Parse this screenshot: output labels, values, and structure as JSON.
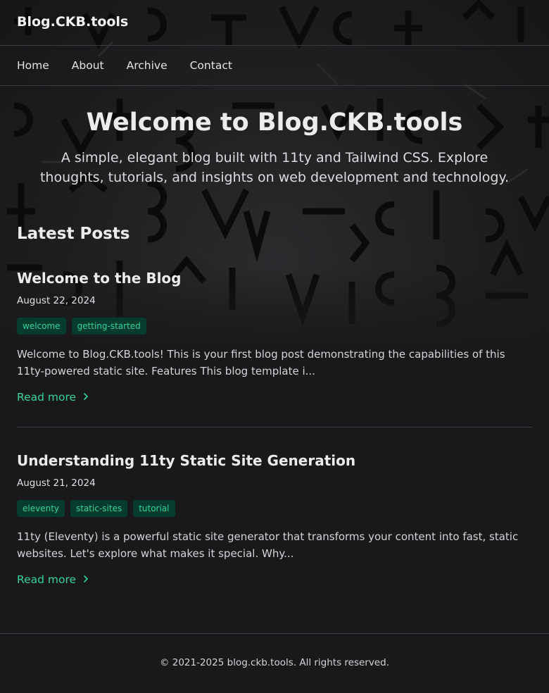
{
  "header": {
    "brand": "Blog.CKB.tools"
  },
  "nav": {
    "items": [
      "Home",
      "About",
      "Archive",
      "Contact"
    ]
  },
  "hero": {
    "title": "Welcome to Blog.CKB.tools",
    "subtitle": "A simple, elegant blog built with 11ty and Tailwind CSS. Explore thoughts, tutorials, and insights on web development and technology."
  },
  "latest": {
    "heading": "Latest Posts",
    "posts": [
      {
        "title": "Welcome to the Blog",
        "date": "August 22, 2024",
        "tags": [
          "welcome",
          "getting-started"
        ],
        "excerpt": "Welcome to Blog.CKB.tools! This is your first blog post demonstrating the capabilities of this 11ty-powered static site. Features This blog template i...",
        "read_more": "Read more"
      },
      {
        "title": "Understanding 11ty Static Site Generation",
        "date": "August 21, 2024",
        "tags": [
          "eleventy",
          "static-sites",
          "tutorial"
        ],
        "excerpt": "11ty (Eleventy) is a powerful static site generator that transforms your content into fast, static websites. Let's explore what makes it special. Why...",
        "read_more": "Read more"
      }
    ]
  },
  "footer": {
    "copyright": "© 2021-2025 blog.ckb.tools. All rights reserved."
  },
  "colors": {
    "accent": "#34d399",
    "tag_bg": "#063c2e",
    "background": "#19191b"
  },
  "icons": {
    "read_more": "chevron-right-icon"
  }
}
